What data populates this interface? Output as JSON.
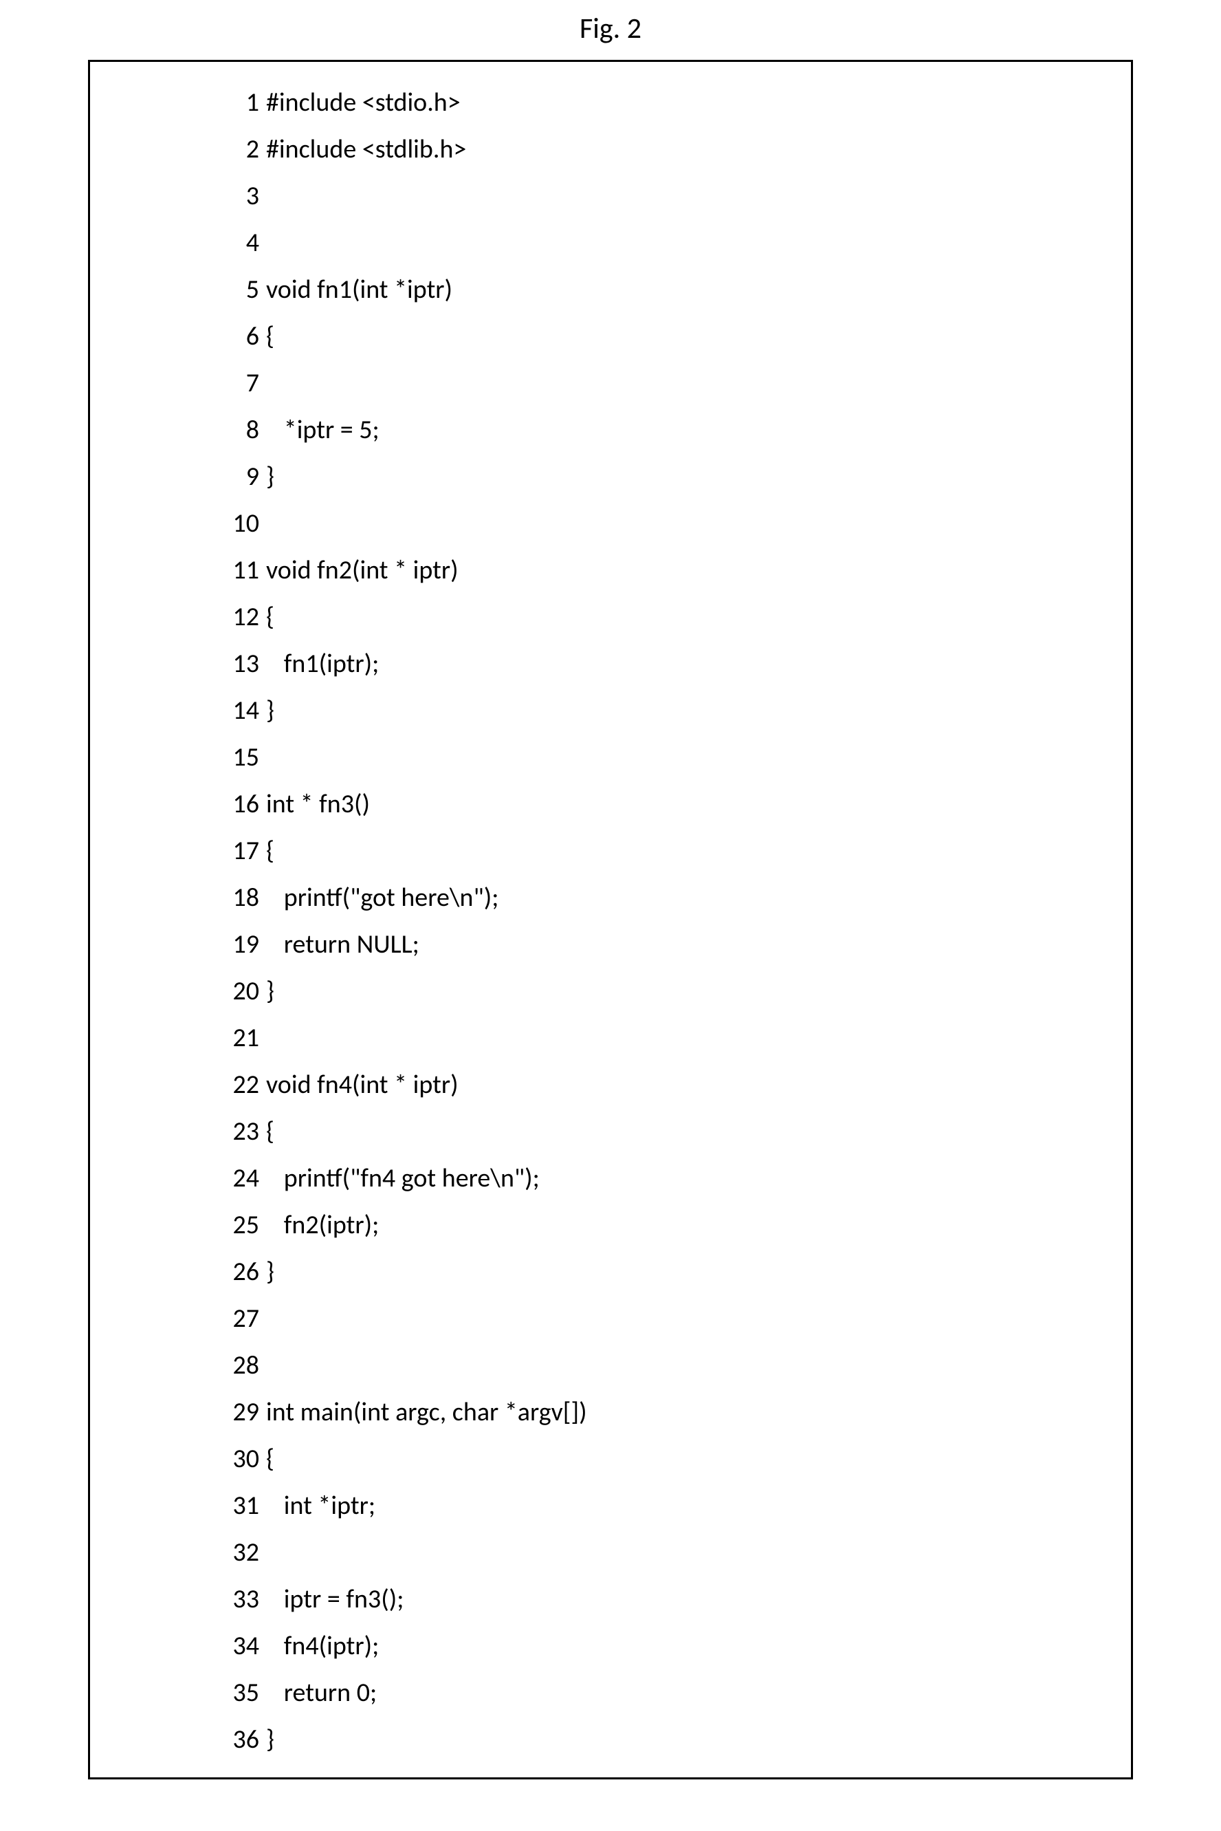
{
  "figure_label": "Fig. 2",
  "code": {
    "lines": [
      {
        "num": "1",
        "text": "#include <stdio.h>"
      },
      {
        "num": "2",
        "text": "#include <stdlib.h>"
      },
      {
        "num": "3",
        "text": ""
      },
      {
        "num": "4",
        "text": ""
      },
      {
        "num": "5",
        "text": "void fn1(int *iptr)"
      },
      {
        "num": "6",
        "text": "{"
      },
      {
        "num": "7",
        "text": ""
      },
      {
        "num": "8",
        "text": "   *iptr = 5;"
      },
      {
        "num": "9",
        "text": "}"
      },
      {
        "num": "10",
        "text": ""
      },
      {
        "num": "11",
        "text": "void fn2(int * iptr)"
      },
      {
        "num": "12",
        "text": "{"
      },
      {
        "num": "13",
        "text": "   fn1(iptr);"
      },
      {
        "num": "14",
        "text": "}"
      },
      {
        "num": "15",
        "text": ""
      },
      {
        "num": "16",
        "text": "int * fn3()"
      },
      {
        "num": "17",
        "text": "{"
      },
      {
        "num": "18",
        "text": "   printf(\"got here\\n\");"
      },
      {
        "num": "19",
        "text": "   return NULL;"
      },
      {
        "num": "20",
        "text": "}"
      },
      {
        "num": "21",
        "text": ""
      },
      {
        "num": "22",
        "text": "void fn4(int * iptr)"
      },
      {
        "num": "23",
        "text": "{"
      },
      {
        "num": "24",
        "text": "   printf(\"fn4 got here\\n\");"
      },
      {
        "num": "25",
        "text": "   fn2(iptr);"
      },
      {
        "num": "26",
        "text": "}"
      },
      {
        "num": "27",
        "text": ""
      },
      {
        "num": "28",
        "text": ""
      },
      {
        "num": "29",
        "text": "int main(int argc, char *argv[])"
      },
      {
        "num": "30",
        "text": "{"
      },
      {
        "num": "31",
        "text": "   int *iptr;"
      },
      {
        "num": "32",
        "text": ""
      },
      {
        "num": "33",
        "text": "   iptr = fn3();"
      },
      {
        "num": "34",
        "text": "   fn4(iptr);"
      },
      {
        "num": "35",
        "text": "   return 0;"
      },
      {
        "num": "36",
        "text": "}"
      }
    ]
  }
}
